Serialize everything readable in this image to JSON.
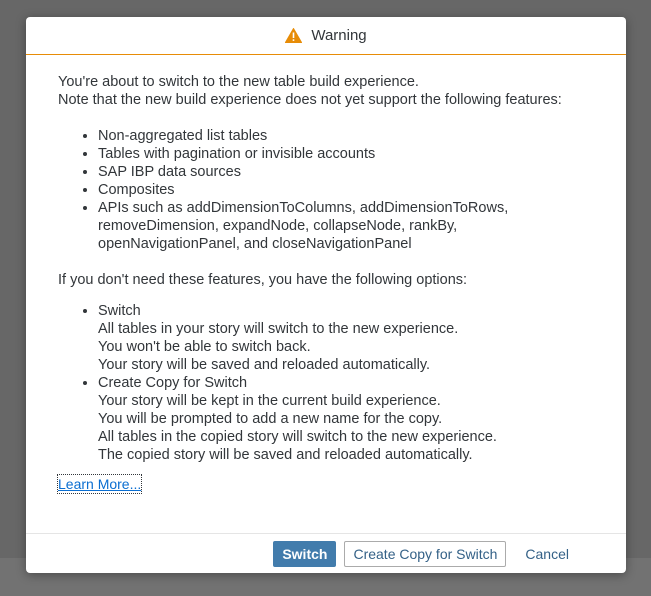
{
  "dialog": {
    "title": "Warning",
    "icon": "warning-triangle-icon",
    "accent_color": "#e78c07",
    "intro": [
      "You're about to switch to the new table build experience.",
      "Note that the new build experience does not yet support the following features:"
    ],
    "features": [
      "Non-aggregated list tables",
      "Tables with pagination or invisible accounts",
      "SAP IBP data sources",
      "Composites",
      "APIs such as addDimensionToColumns, addDimensionToRows, removeDimension, expandNode, collapseNode, rankBy, openNavigationPanel, and closeNavigationPanel"
    ],
    "options_lead": "If you don't need these features, you have the following options:",
    "options": [
      {
        "title": "Switch",
        "lines": [
          "All tables in your story will switch to the new experience.",
          "You won't be able to switch back.",
          "Your story will be saved and reloaded automatically."
        ]
      },
      {
        "title": "Create Copy for Switch",
        "lines": [
          "Your story will be kept in the current build experience.",
          "You will be prompted to add a new name for the copy.",
          "All tables in the copied story will switch to the new experience.",
          "The copied story will be saved and reloaded automatically."
        ]
      }
    ],
    "learn_more": "Learn More...",
    "buttons": {
      "switch": "Switch",
      "create_copy": "Create Copy for Switch",
      "cancel": "Cancel"
    }
  }
}
